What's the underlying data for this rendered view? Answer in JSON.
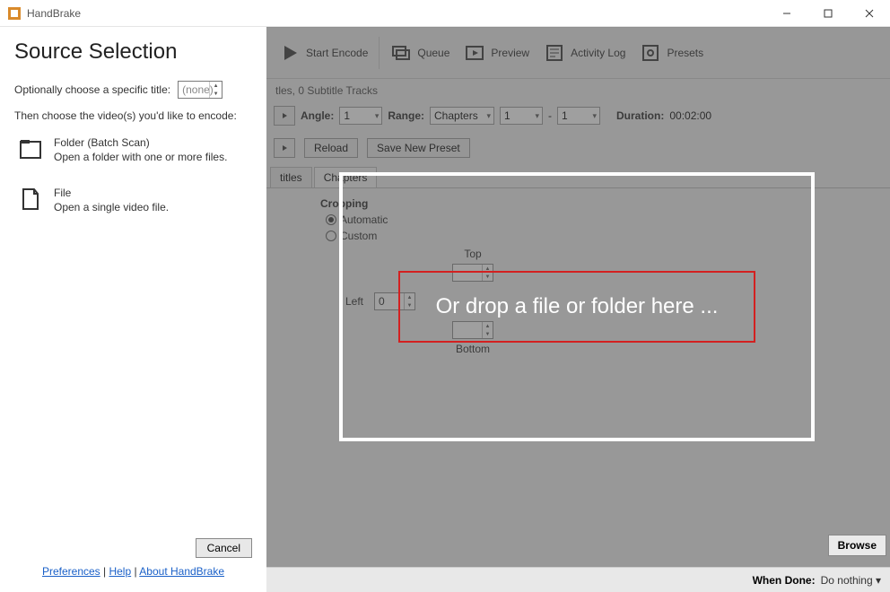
{
  "app": {
    "title": "HandBrake"
  },
  "window_controls": {
    "minimize": "minimize",
    "maximize": "maximize",
    "close": "close"
  },
  "source_panel": {
    "heading": "Source Selection",
    "title_choose_label": "Optionally choose a specific title:",
    "title_value": "(none)",
    "instruction": "Then choose the video(s) you'd like to encode:",
    "folder_title": "Folder (Batch Scan)",
    "folder_desc": "Open a folder with one or more files.",
    "file_title": "File",
    "file_desc": "Open a single video file.",
    "cancel": "Cancel",
    "links": {
      "preferences": "Preferences",
      "help": "Help",
      "about": "About HandBrake"
    }
  },
  "toolbar": {
    "start_encode": "Start Encode",
    "queue": "Queue",
    "preview": "Preview",
    "activity_log": "Activity Log",
    "presets": "Presets"
  },
  "tracks_info": "tles, 0 Subtitle Tracks",
  "params": {
    "angle_label": "Angle:",
    "angle_value": "1",
    "range_label": "Range:",
    "range_type": "Chapters",
    "range_from": "1",
    "dash": "-",
    "range_to": "1",
    "duration_label": "Duration:",
    "duration_value": "00:02:00"
  },
  "preset_row": {
    "reload": "Reload",
    "save_new": "Save New Preset"
  },
  "tabs": {
    "subtitles_partial": "titles",
    "chapters": "Chapters"
  },
  "cropping": {
    "title": "Cropping",
    "automatic": "Automatic",
    "custom": "Custom",
    "top": "Top",
    "bottom": "Bottom",
    "left": "Left",
    "left_value": "0"
  },
  "drop_overlay": {
    "text": "Or drop a file or folder here ..."
  },
  "browse": "Browse",
  "bottom": {
    "when_done_label": "When Done:",
    "when_done_value": "Do nothing"
  }
}
